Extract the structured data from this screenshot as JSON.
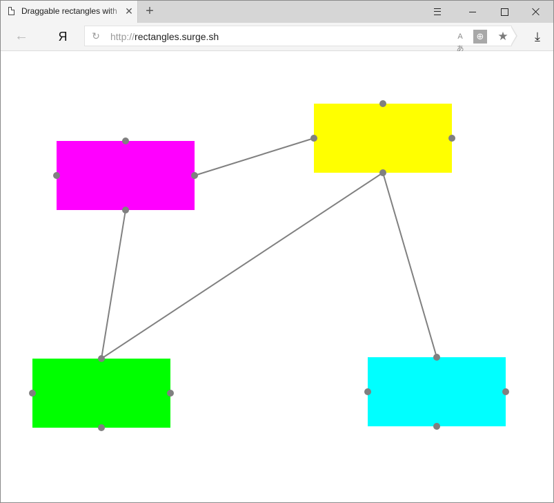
{
  "window": {
    "tab": {
      "title": "Draggable rectangles with",
      "close_glyph": "✕",
      "doc_icon": "page-icon"
    },
    "new_tab_glyph": "+",
    "controls": {
      "menu_icon": "hamburger-icon",
      "minimize_icon": "minimize-icon",
      "maximize_icon": "maximize-icon",
      "close_icon": "close-icon"
    }
  },
  "navbar": {
    "back_glyph": "←",
    "browser_logo": "Я",
    "refresh_glyph": "↻",
    "url_scheme": "http://",
    "url_host": "rectangles.surge.sh",
    "translate_glyph": "Aあ",
    "globe_glyph": "⊕",
    "star_glyph": "★",
    "download_glyph": "⤓"
  },
  "canvas": {
    "connector_color": "#808080",
    "handle_color": "#808080",
    "rectangles": [
      {
        "id": "magenta",
        "color": "#ff00ff"
      },
      {
        "id": "yellow",
        "color": "#ffff00"
      },
      {
        "id": "green",
        "color": "#00ff00"
      },
      {
        "id": "cyan",
        "color": "#00ffff"
      }
    ],
    "connections": [
      {
        "from": "magenta.right",
        "to": "yellow.left"
      },
      {
        "from": "magenta.bottom",
        "to": "green.top"
      },
      {
        "from": "yellow.bottom",
        "to": "green.top"
      },
      {
        "from": "yellow.bottom",
        "to": "cyan.top"
      }
    ]
  }
}
